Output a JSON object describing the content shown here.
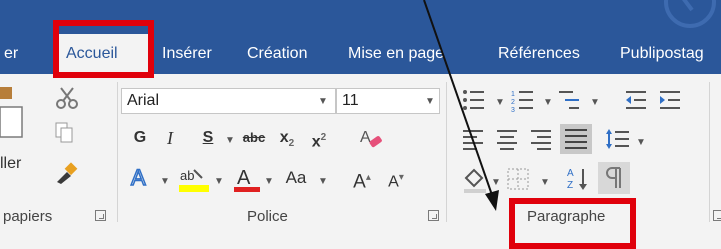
{
  "tabs": [
    {
      "label": "er"
    },
    {
      "label": "Accueil"
    },
    {
      "label": "Insérer"
    },
    {
      "label": "Création"
    },
    {
      "label": "Mise en page"
    },
    {
      "label": "Références"
    },
    {
      "label": "Publipostag"
    }
  ],
  "clipboard": {
    "paste_label": "ller",
    "group_label": "papiers"
  },
  "font": {
    "name": "Arial",
    "size": "11",
    "bold": "G",
    "italic": "I",
    "underline": "S",
    "strike": "abc",
    "subscript": "x",
    "superscript": "x",
    "change_case": "Aa",
    "grow": "A",
    "shrink": "A",
    "group_label": "Police"
  },
  "paragraph": {
    "group_label": "Paragraphe"
  },
  "colors": {
    "accent": "#2b579a",
    "highlight": "#ffff00",
    "font_color": "#e02020",
    "annotation": "#e0000b"
  }
}
